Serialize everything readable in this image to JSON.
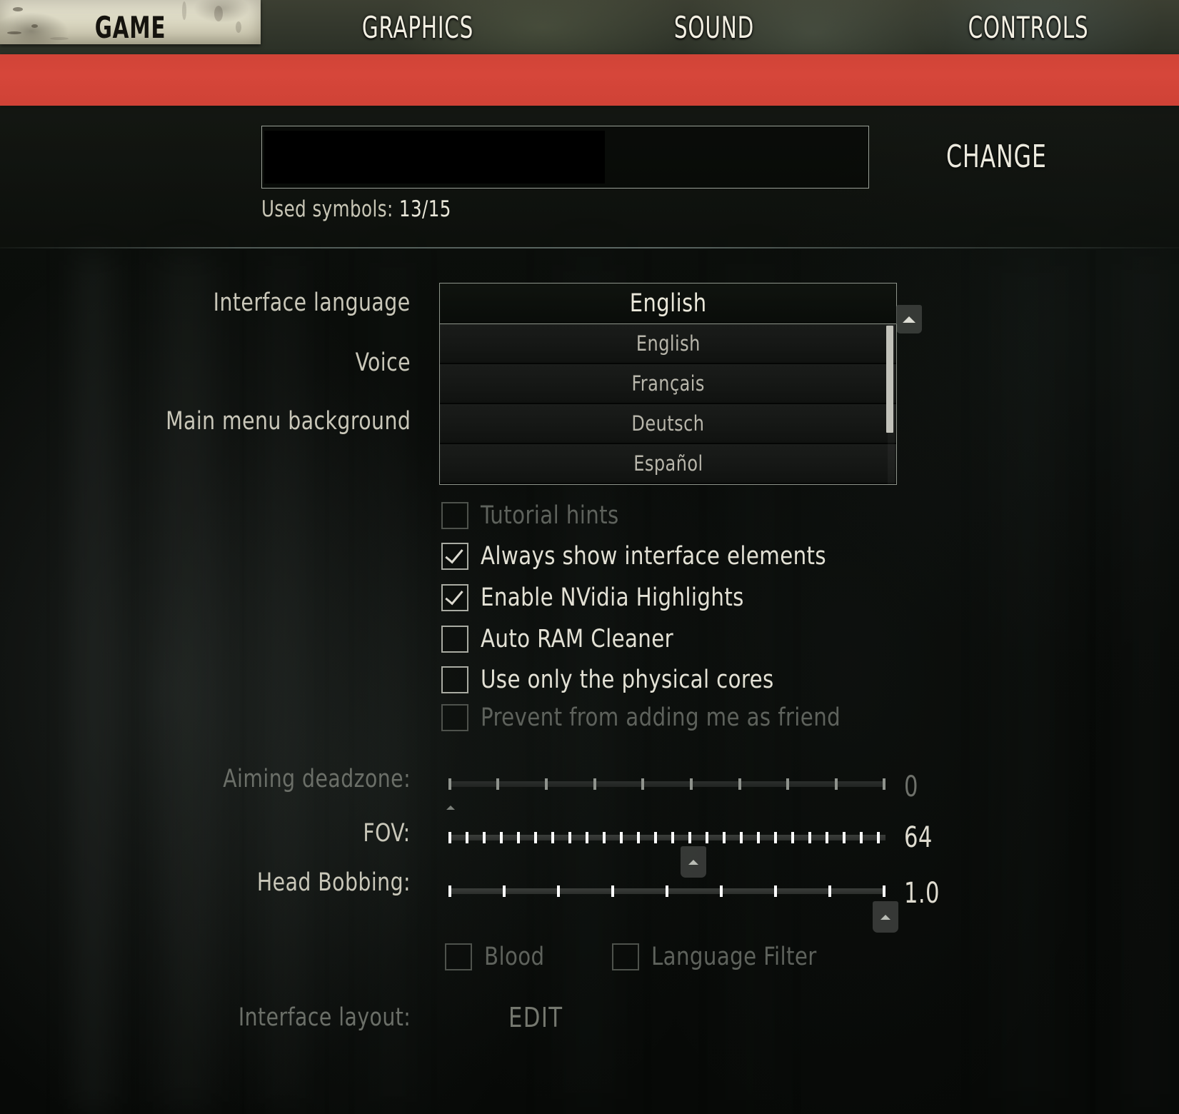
{
  "tabs": [
    {
      "label": "GAME",
      "active": true
    },
    {
      "label": "GRAPHICS",
      "active": false
    },
    {
      "label": "SOUND",
      "active": false
    },
    {
      "label": "CONTROLS",
      "active": false
    }
  ],
  "nickname": {
    "value": "",
    "redacted": true,
    "used_symbols_label": "Used symbols:",
    "used_symbols_count": "13/15",
    "change_button": "CHANGE"
  },
  "settings": {
    "interface_language_label": "Interface language",
    "voice_label": "Voice",
    "main_menu_background_label": "Main menu background",
    "language_dropdown": {
      "selected": "English",
      "expanded": true,
      "options": [
        "English",
        "Français",
        "Deutsch",
        "Español"
      ]
    }
  },
  "checkboxes": [
    {
      "label": "Tutorial hints",
      "checked": false,
      "disabled": true
    },
    {
      "label": "Always show interface elements",
      "checked": true,
      "disabled": false
    },
    {
      "label": "Enable NVidia Highlights",
      "checked": true,
      "disabled": false
    },
    {
      "label": "Auto RAM Cleaner",
      "checked": false,
      "disabled": false
    },
    {
      "label": "Use only the physical cores",
      "checked": false,
      "disabled": false
    },
    {
      "label": "Prevent from adding me as friend",
      "checked": false,
      "disabled": true
    }
  ],
  "sliders": [
    {
      "label": "Aiming deadzone:",
      "value": "0",
      "disabled": true,
      "fill_pct": 0,
      "ticks": 10
    },
    {
      "label": "FOV:",
      "value": "64",
      "disabled": false,
      "fill_pct": 56,
      "ticks": 26
    },
    {
      "label": "Head Bobbing:",
      "value": "1.0",
      "disabled": false,
      "fill_pct": 100,
      "ticks": 9
    }
  ],
  "bottom_checkboxes": [
    {
      "label": "Blood",
      "checked": false,
      "disabled": true
    },
    {
      "label": "Language Filter",
      "checked": false,
      "disabled": true
    }
  ],
  "interface_layout": {
    "label": "Interface layout:",
    "edit_button": "EDIT"
  },
  "colors": {
    "accent_red": "#d14437",
    "text_primary": "#e3e1d5",
    "text_dim": "#5e625c",
    "tab_active_plate": "#e9e6d4"
  }
}
